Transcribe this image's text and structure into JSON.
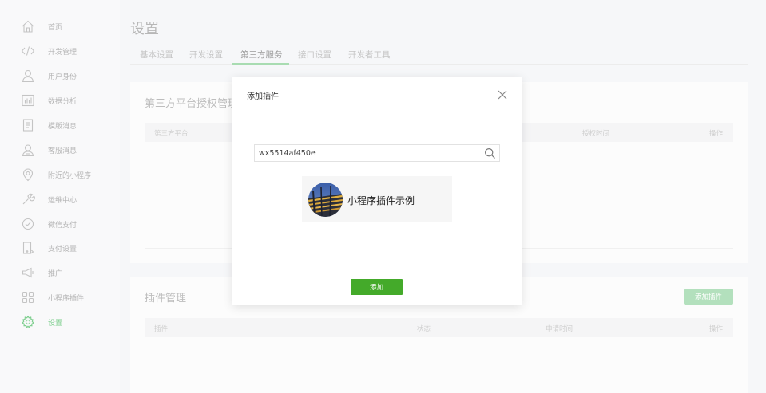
{
  "sidebar": {
    "items": [
      {
        "label": "首页",
        "icon": "home-icon"
      },
      {
        "label": "开发管理",
        "icon": "code-icon"
      },
      {
        "label": "用户身份",
        "icon": "user-icon"
      },
      {
        "label": "数据分析",
        "icon": "chart-icon"
      },
      {
        "label": "模版消息",
        "icon": "document-icon"
      },
      {
        "label": "客服消息",
        "icon": "customer-service-icon"
      },
      {
        "label": "附近的小程序",
        "icon": "location-icon"
      },
      {
        "label": "运维中心",
        "icon": "wrench-icon"
      },
      {
        "label": "微信支付",
        "icon": "payment-icon"
      },
      {
        "label": "支付设置",
        "icon": "payment-settings-icon"
      },
      {
        "label": "推广",
        "icon": "megaphone-icon"
      },
      {
        "label": "小程序插件",
        "icon": "plugin-icon"
      },
      {
        "label": "设置",
        "icon": "gear-icon"
      }
    ],
    "active_index": 12,
    "active_color": "#7fcf8f"
  },
  "page": {
    "title": "设置",
    "tabs": [
      "基本设置",
      "开发设置",
      "第三方服务",
      "接口设置",
      "开发者工具"
    ],
    "active_tab": "第三方服务"
  },
  "third_party_panel": {
    "title": "第三方平台授权管理",
    "columns": [
      "第三方平台",
      "授权时间",
      "操作"
    ]
  },
  "plugin_panel": {
    "title": "插件管理",
    "add_button": "添加插件",
    "columns": [
      "插件",
      "状态",
      "申请时间",
      "操作"
    ]
  },
  "dialog": {
    "title": "添加插件",
    "search_value": "wx5514af450e",
    "result_name": "小程序插件示例",
    "confirm_button": "添加",
    "confirm_color": "#44aa2a"
  }
}
